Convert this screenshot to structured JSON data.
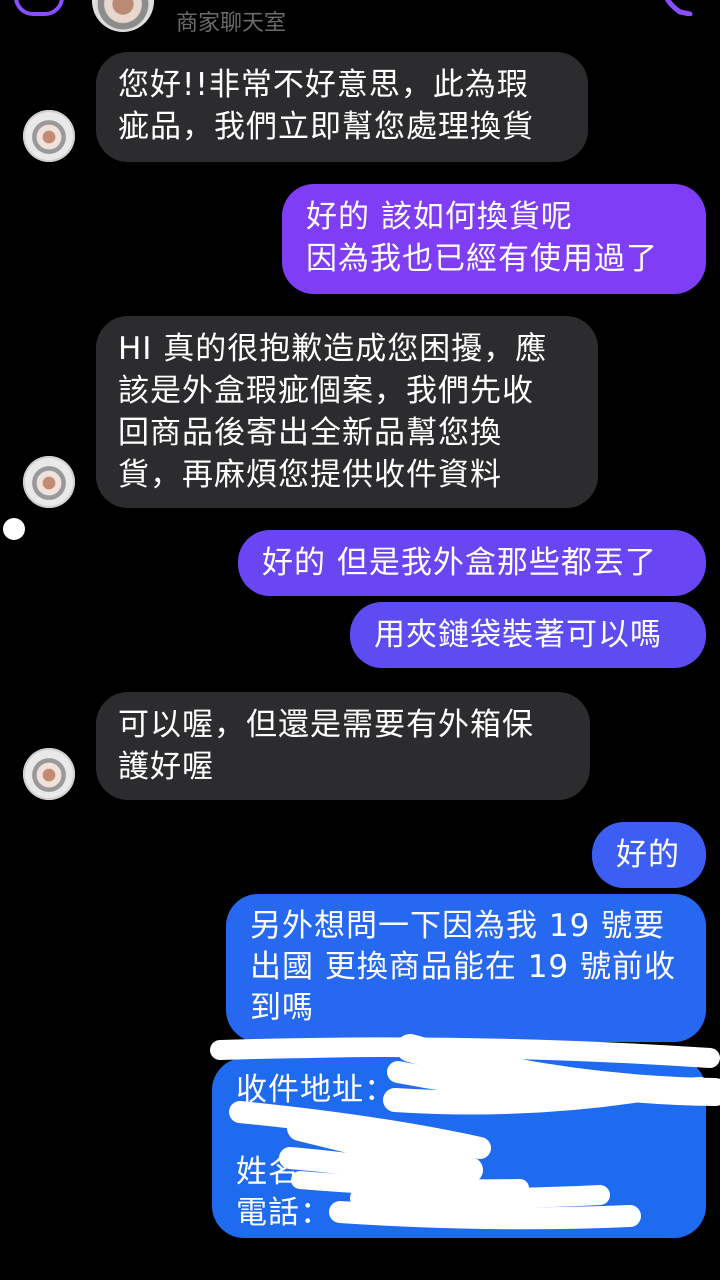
{
  "header": {
    "title": "商家聊天室",
    "back_icon": "back-arrow-icon",
    "call_icon": "phone-icon",
    "accent_color": "#8a4dff"
  },
  "messages": [
    {
      "from": "merchant",
      "text": "您好!!非常不好意思，此為瑕\n疵品，我們立即幫您處理換貨"
    },
    {
      "from": "user",
      "text": "好的 該如何換貨呢\n因為我也已經有使用過了"
    },
    {
      "from": "merchant",
      "text": "HI 真的很抱歉造成您困擾，應\n該是外盒瑕疵個案，我們先收\n回商品後寄出全新品幫您換\n貨，再麻煩您提供收件資料"
    },
    {
      "from": "user",
      "text": "好的 但是我外盒那些都丟了"
    },
    {
      "from": "user",
      "text": "用夾鏈袋裝著可以嗎"
    },
    {
      "from": "merchant",
      "text": "可以喔，但還是需要有外箱保\n護好喔"
    },
    {
      "from": "user",
      "text": "好的"
    },
    {
      "from": "user",
      "text": "另外想問一下因為我 19 號要\n出國 更換商品能在 19 號前收\n到嗎"
    },
    {
      "from": "user",
      "text": "收件地址：\n\n姓名\n電話："
    }
  ],
  "colors": {
    "incoming_bubble": "#2c2c2e",
    "outgoing_purple": "#7f3df5",
    "outgoing_indigo": "#5b4cf2",
    "outgoing_blue": "#1f6bf0"
  }
}
